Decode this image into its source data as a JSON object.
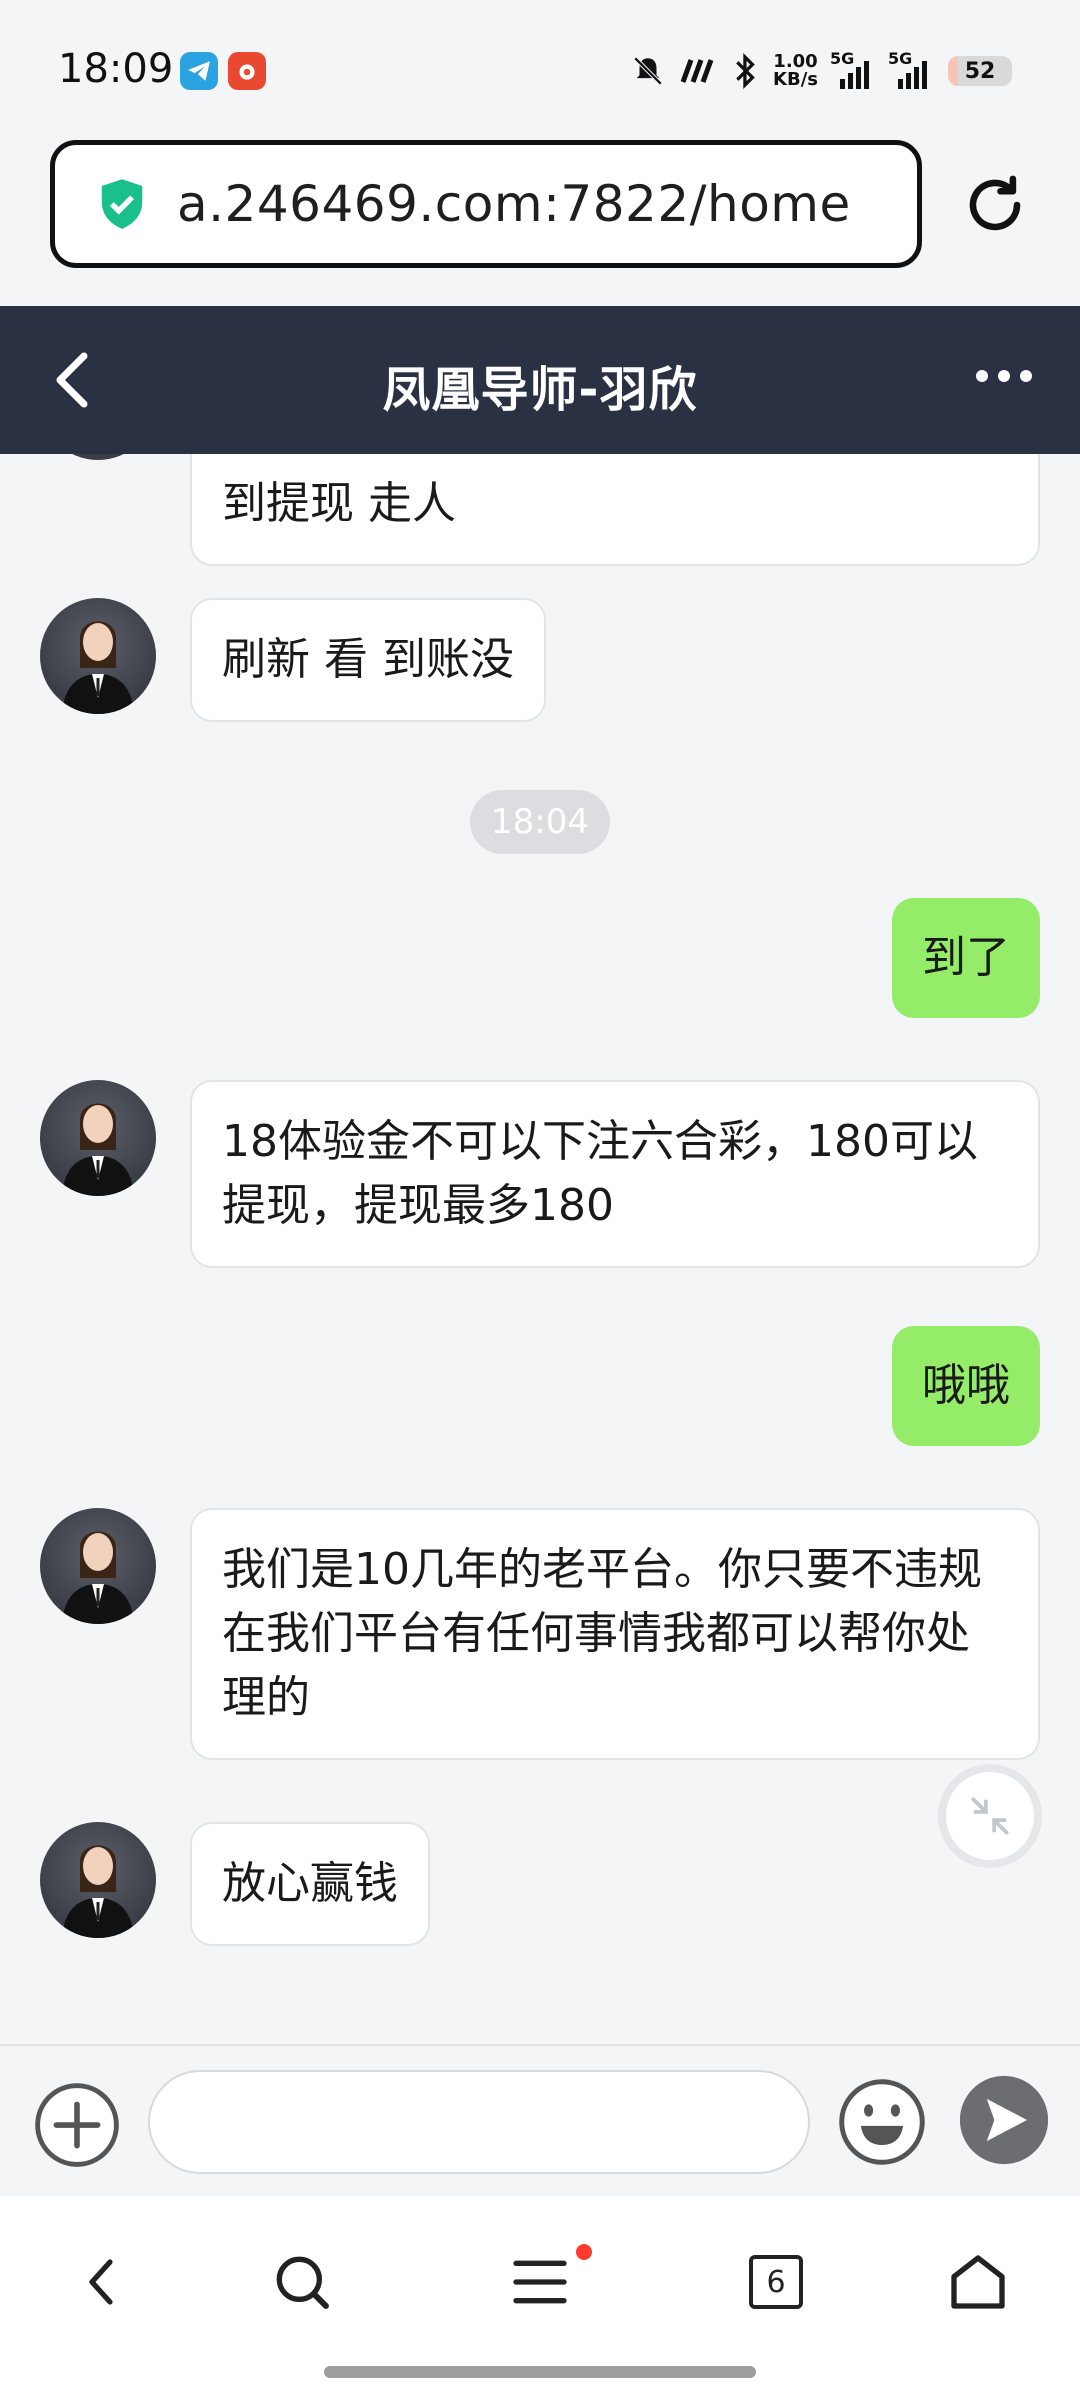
{
  "status_bar": {
    "time": "18:09",
    "net_speed_value": "1.00",
    "net_speed_unit": "KB/s",
    "sim1_label": "5G",
    "sim2_label": "5G",
    "battery": "52"
  },
  "browser": {
    "url": "a.246469.com:7822/home",
    "tab_count": "6"
  },
  "chat": {
    "title": "凤凰导师-羽欣",
    "timestamp": "18:04",
    "messages": [
      {
        "side": "in",
        "text": "到提现 走人"
      },
      {
        "side": "in",
        "text": "刷新 看 到账没"
      },
      {
        "side": "out",
        "text": "到了"
      },
      {
        "side": "in",
        "text": "18体验金不可以下注六合彩，180可以提现，提现最多180"
      },
      {
        "side": "out",
        "text": "哦哦"
      },
      {
        "side": "in",
        "text": "我们是10几年的老平台。你只要不违规在我们平台有任何事情我都可以帮你处理的"
      },
      {
        "side": "in",
        "text": "放心赢钱"
      }
    ]
  },
  "input": {
    "placeholder": ""
  },
  "colors": {
    "header_bg": "#2a3142",
    "outgoing_bubble": "#95ec69",
    "incoming_bubble": "#ffffff",
    "shield_green": "#19c08b"
  }
}
